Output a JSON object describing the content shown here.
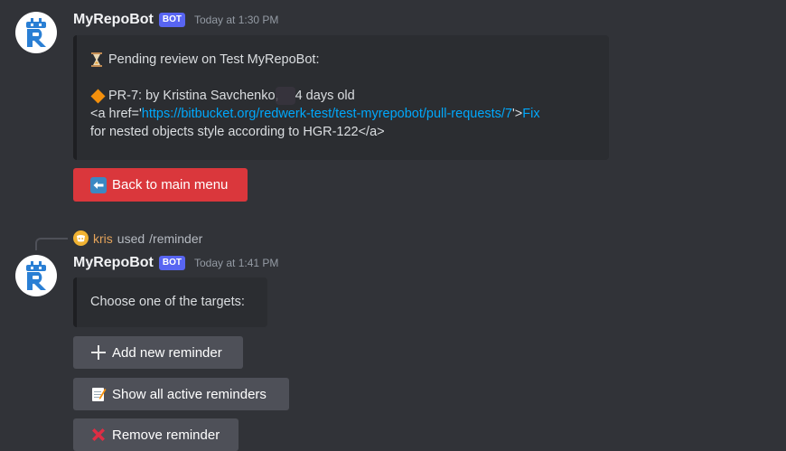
{
  "message1": {
    "author": "MyRepoBot",
    "tag": "BOT",
    "timestamp": "Today at 1:30 PM",
    "embed": {
      "line1": "Pending review on Test MyRepoBot:",
      "pr_prefix": "PR-7: by Kristina Savchenko,",
      "pr_age": "4 days old",
      "anchor_open": "<a href='",
      "url": "https://bitbucket.org/redwerk-test/test-myrepobot/pull-requests/7",
      "anchor_mid": "'>",
      "fix_word": "Fix",
      "line_last": "for nested objects style according to HGR-122</a>"
    },
    "button_label": "Back to main menu"
  },
  "command": {
    "username": "kris",
    "used": "used",
    "command": "/reminder"
  },
  "message2": {
    "author": "MyRepoBot",
    "tag": "BOT",
    "timestamp": "Today at 1:41 PM",
    "embed_text": "Choose one of the targets:",
    "buttons": [
      {
        "label": "Add new reminder",
        "icon": "plus-icon"
      },
      {
        "label": "Show all active reminders",
        "icon": "memo-icon"
      },
      {
        "label": "Remove reminder",
        "icon": "cross-mark-icon"
      }
    ]
  },
  "colors": {
    "background": "#313338",
    "embed": "#2b2d31",
    "danger": "#da373c",
    "secondary": "#4e5058",
    "link": "#00a8fc",
    "bot_tag": "#5865f2"
  }
}
